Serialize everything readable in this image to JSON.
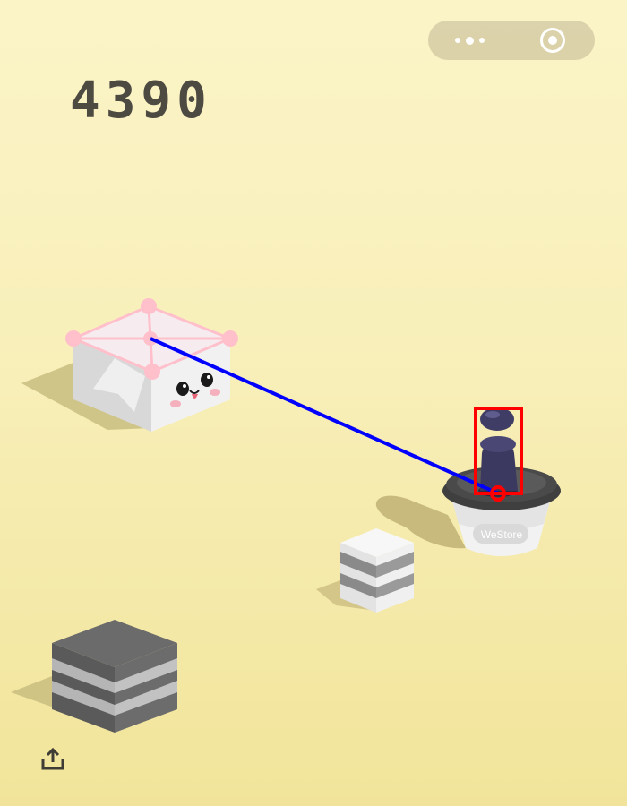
{
  "score": "4390",
  "capsule": {
    "menu_icon": "more-dots-icon",
    "close_icon": "target-close-icon"
  },
  "share_icon": "share-upload-icon",
  "store_label": "WeStore",
  "colors": {
    "background_top": "#fbf4c7",
    "background_bottom": "#f1e49a",
    "score_text": "#4d4a42",
    "trajectory_line": "#0000ff",
    "piece_box": "#ff0000",
    "target_marker": "#ffc0cb"
  }
}
